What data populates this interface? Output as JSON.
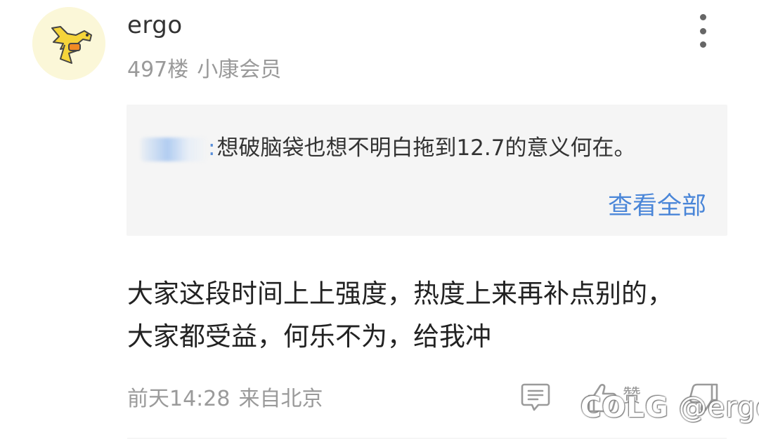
{
  "post": {
    "username": "ergo",
    "floor": "497楼",
    "member_level": "小康会员",
    "quote": {
      "text": "想破脑袋也想不明白拖到12.7的意义何在。",
      "view_all": "查看全部"
    },
    "content_lines": [
      "大家这段时间上上强度，热度上来再补点别的，",
      "大家都受益，何乐不为，给我冲"
    ],
    "time": "前天14:28",
    "location": "来自北京",
    "like_label": "赞"
  },
  "watermark": {
    "brand": "COLG",
    "handle": "@ergo"
  },
  "icons": {
    "more": "more-vertical-icon",
    "reply": "comment-icon",
    "like": "thumbs-up-icon",
    "dislike": "thumbs-down-icon"
  },
  "colors": {
    "link": "#4a86d8",
    "meta": "#9a9a9a",
    "quote_bg": "#f5f5f5",
    "avatar_bg": "#fbf7d8"
  }
}
